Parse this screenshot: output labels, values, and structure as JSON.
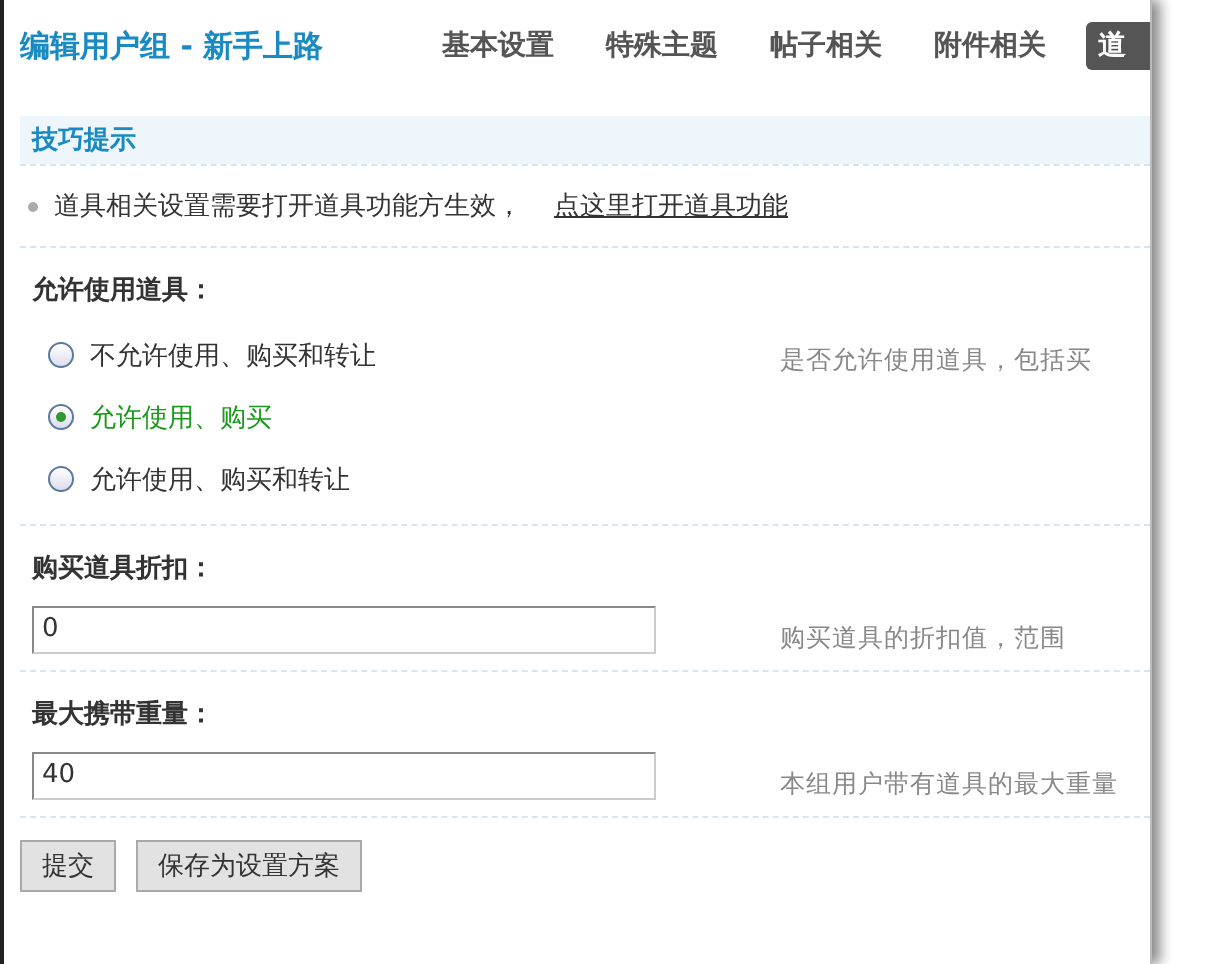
{
  "title": "编辑用户组 - 新手上路",
  "tabs": [
    {
      "label": "基本设置",
      "selected": false
    },
    {
      "label": "特殊主题",
      "selected": false
    },
    {
      "label": "帖子相关",
      "selected": false
    },
    {
      "label": "附件相关",
      "selected": false
    },
    {
      "label": "道",
      "selected": true
    }
  ],
  "tips": {
    "heading": "技巧提示",
    "text": "道具相关设置需要打开道具功能方生效，",
    "link": "点这里打开道具功能"
  },
  "settings": [
    {
      "kind": "radio",
      "label": "允许使用道具：",
      "hint": "是否允许使用道具，包括买",
      "options": [
        {
          "label": "不允许使用、购买和转让",
          "selected": false
        },
        {
          "label": "允许使用、购买",
          "selected": true
        },
        {
          "label": "允许使用、购买和转让",
          "selected": false
        }
      ]
    },
    {
      "kind": "text",
      "label": "购买道具折扣：",
      "value": "0",
      "hint": "购买道具的折扣值，范围"
    },
    {
      "kind": "text",
      "label": "最大携带重量：",
      "value": "40",
      "hint": "本组用户带有道具的最大重量"
    }
  ],
  "buttons": [
    "提交",
    "保存为设置方案"
  ]
}
